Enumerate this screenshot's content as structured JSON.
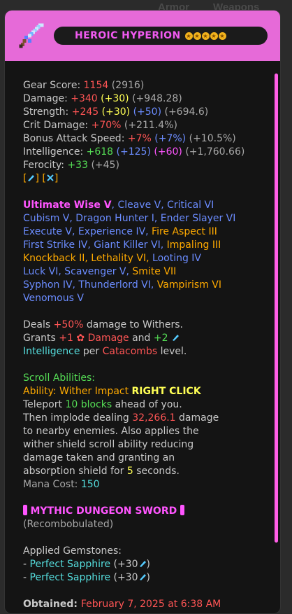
{
  "background": {
    "tab_armor": "Armor",
    "tab_weapons": "Weapons"
  },
  "header": {
    "item_name": "HEROIC HYPERION",
    "stars": [
      "★",
      "★",
      "★",
      "★",
      "★"
    ],
    "accent": "#e66ad8"
  },
  "stats": {
    "gear_score_label": "Gear Score:",
    "gear_score": "1154",
    "gear_score_alt": "(2916)",
    "damage_label": "Damage:",
    "damage": "+340",
    "damage_bonus": "(+30)",
    "damage_extra": "(+948.28)",
    "strength_label": "Strength:",
    "strength": "+245",
    "strength_bonus": "(+30)",
    "strength_bonus2": "(+50)",
    "strength_extra": "(+694.6)",
    "crit_label": "Crit Damage:",
    "crit": "+70%",
    "crit_extra": "(+211.4%)",
    "bas_label": "Bonus Attack Speed:",
    "bas": "+7%",
    "bas_bonus": "(+7%)",
    "bas_extra": "(+10.5%)",
    "int_label": "Intelligence:",
    "int": "+618",
    "int_bonus": "(+125)",
    "int_bonus2": "(+60)",
    "int_extra": "(+1,760.66)",
    "ferocity_label": "Ferocity:",
    "ferocity": "+33",
    "ferocity_extra": "(+45)"
  },
  "enchants": {
    "ultimate": "Ultimate Wise V",
    "l1_rest": ", Cleave V, Critical VI",
    "l2": "Cubism V, Dragon Hunter I, Ender Slayer VI",
    "l3_a": "Execute V, Experience IV, ",
    "l3_b": "Fire Aspect III",
    "l4_a": "First Strike IV, Giant Killer VI, ",
    "l4_b": "Impaling III",
    "l5_a": "Knockback II, Lethality VI, ",
    "l5_b": "Looting IV",
    "l6_a": "Luck VI, Scavenger V, ",
    "l6_b": "Smite VII",
    "l7_a": "Syphon IV, Thunderlord VI, ",
    "l7_b": "Vampirism VI",
    "l8": "Venomous V"
  },
  "desc": {
    "deals": "Deals ",
    "deals_val": "+50%",
    "deals_rest": " damage to Withers.",
    "grants": "Grants ",
    "grants_val": "+1",
    "grants_damage": "Damage",
    "grants_and": " and ",
    "grants_val2": "+2",
    "intelligence": "Intelligence",
    "per": " per ",
    "catacombs": "Catacombs",
    "level": " level."
  },
  "scroll": {
    "title": "Scroll Abilities:",
    "ability": "Ability: Wither Impact ",
    "right_click": "RIGHT CLICK",
    "l1_a": "Teleport ",
    "l1_b": "10 blocks",
    "l1_c": " ahead of you.",
    "l2_a": "Then implode dealing ",
    "l2_b": "32,266.1",
    "l2_c": " damage",
    "l3": "to nearby enemies. Also applies the",
    "l4": "wither shield scroll ability reducing",
    "l5": "damage taken and granting an",
    "l6_a": "absorption shield for ",
    "l6_b": "5",
    "l6_c": " seconds.",
    "mana_label": "Mana Cost: ",
    "mana": "150"
  },
  "rarity": {
    "label": "MYTHIC DUNGEON SWORD",
    "recomb": "(Recombobulated)"
  },
  "gems": {
    "title": "Applied Gemstones:",
    "items": [
      {
        "dash": "- ",
        "name": "Perfect Sapphire",
        "bonus": "(+30"
      },
      {
        "dash": "- ",
        "name": "Perfect Sapphire",
        "bonus": "(+30"
      }
    ],
    "close": ")"
  },
  "obtained": {
    "label": "Obtained: ",
    "date": "February 7, 2025 at 6:38 AM"
  }
}
